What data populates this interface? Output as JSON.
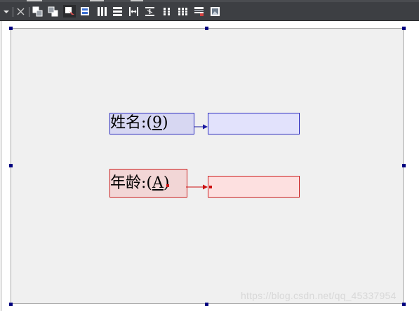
{
  "toolbar": {
    "buttons": [
      {
        "name": "dropdown-arrow-icon"
      },
      {
        "name": "close-icon"
      },
      {
        "name": "bring-to-front-icon"
      },
      {
        "name": "send-to-back-icon"
      },
      {
        "name": "tab-order-icon"
      },
      {
        "name": "properties-icon"
      },
      {
        "name": "align-columns-icon"
      },
      {
        "name": "align-rows-icon"
      },
      {
        "name": "center-horizontal-icon"
      },
      {
        "name": "center-vertical-icon"
      },
      {
        "name": "equal-spacing-icon"
      },
      {
        "name": "grid-icon"
      },
      {
        "name": "format-list-icon"
      },
      {
        "name": "image-icon"
      }
    ]
  },
  "form": {
    "name_label": "姓名:(",
    "name_hotkey": "9",
    "name_close": ")",
    "age_label": "年龄:(",
    "age_hotkey": "A",
    "age_close": ")",
    "name_field_value": "",
    "age_field_value": ""
  },
  "colors": {
    "toolbar_bg": "#3d3f43",
    "panel_bg": "#f0f0f0",
    "selection_handle": "#000080",
    "blue_label_bg": "#d7d7f2",
    "blue_border": "#2c2cbf",
    "red_label_bg": "#f2d6d6",
    "red_border": "#cc2020"
  },
  "watermark": {
    "text": "https://blog.csdn.net/qq_45337954"
  }
}
